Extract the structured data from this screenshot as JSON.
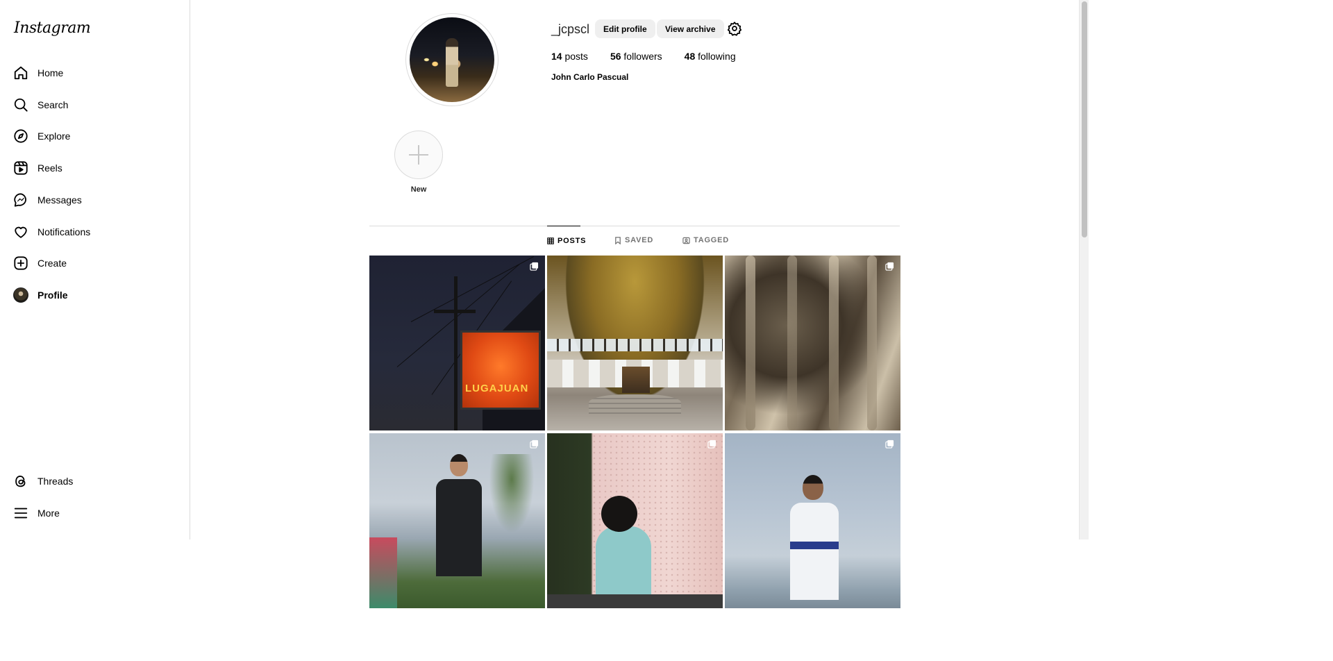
{
  "brand": {
    "logo_text": "Instagram"
  },
  "sidebar": {
    "items": [
      {
        "label": "Home",
        "icon": "home-icon"
      },
      {
        "label": "Search",
        "icon": "search-icon"
      },
      {
        "label": "Explore",
        "icon": "compass-icon"
      },
      {
        "label": "Reels",
        "icon": "reels-icon"
      },
      {
        "label": "Messages",
        "icon": "messenger-icon"
      },
      {
        "label": "Notifications",
        "icon": "heart-icon"
      },
      {
        "label": "Create",
        "icon": "plus-square-icon"
      },
      {
        "label": "Profile",
        "icon": "avatar"
      }
    ],
    "bottom_items": [
      {
        "label": "Threads",
        "icon": "threads-icon"
      },
      {
        "label": "More",
        "icon": "menu-icon"
      }
    ]
  },
  "profile": {
    "username": "_jcpscl",
    "edit_profile_label": "Edit profile",
    "view_archive_label": "View archive",
    "posts_count": "14",
    "posts_label": "posts",
    "followers_count": "56",
    "followers_label": "followers",
    "following_count": "48",
    "following_label": "following",
    "full_name": "John Carlo Pascual"
  },
  "highlights": {
    "new_label": "New"
  },
  "tabs": [
    {
      "label": "POSTS",
      "icon": "grid-icon",
      "active": true
    },
    {
      "label": "SAVED",
      "icon": "bookmark-icon",
      "active": false
    },
    {
      "label": "TAGGED",
      "icon": "tag-icon",
      "active": false
    }
  ],
  "posts": {
    "sign_text": "LUGAJUAN",
    "multi_flags": [
      true,
      false,
      true,
      true,
      true,
      true
    ]
  },
  "colors": {
    "border": "#dbdbdb",
    "button_bg": "#efefef",
    "muted_text": "#737373"
  }
}
